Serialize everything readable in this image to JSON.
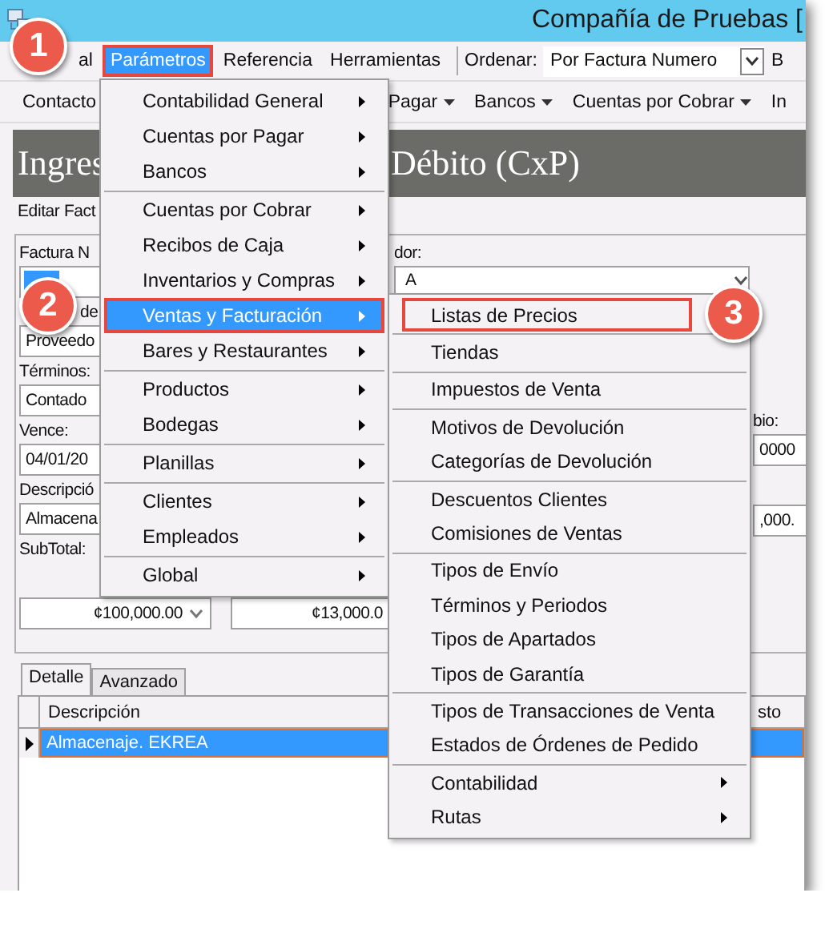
{
  "window": {
    "title": "Compañía de Pruebas ["
  },
  "menu_bar": [
    {
      "label": "al",
      "selected": false,
      "marked": false
    },
    {
      "label": "Parámetros",
      "selected": true,
      "marked": true
    },
    {
      "label": "Referencia",
      "selected": false,
      "marked": false
    },
    {
      "label": "Herramientas",
      "selected": false,
      "marked": false
    }
  ],
  "sort": {
    "label": "Ordenar:",
    "value": "Por Factura Numero"
  },
  "menu_bar_overflow": "B",
  "toolbar": [
    {
      "label": "Contacto",
      "dropdown": false
    },
    {
      "label": "Pagar",
      "dropdown": true
    },
    {
      "label": "Bancos",
      "dropdown": true
    },
    {
      "label": "Cuentas por Cobrar",
      "dropdown": true
    },
    {
      "label": "In",
      "dropdown": false
    }
  ],
  "header": {
    "left": "Ingres",
    "right": "Débito (CxP)"
  },
  "form_tab": "Editar Fact",
  "form": {
    "left": [
      {
        "kind": "label",
        "text": "Factura N"
      },
      {
        "kind": "selection"
      },
      {
        "kind": "label",
        "text": "de"
      },
      {
        "kind": "field",
        "text": "Proveedo"
      },
      {
        "kind": "label",
        "text": "Términos:"
      },
      {
        "kind": "field",
        "text": "Contado"
      },
      {
        "kind": "label",
        "text": "Vence:"
      },
      {
        "kind": "field",
        "text": "04/01/20"
      },
      {
        "kind": "label",
        "text": "Descripció"
      },
      {
        "kind": "field",
        "text": "Almacena"
      },
      {
        "kind": "label",
        "text": "SubTotal:"
      }
    ],
    "amounts": [
      {
        "text": "¢100,000.00",
        "dropdown": true
      },
      {
        "text": "¢13,000.0",
        "dropdown": false
      }
    ],
    "middle": [
      {
        "kind": "label",
        "text": "dor:"
      },
      {
        "kind": "combo",
        "text": "A"
      }
    ],
    "right": [
      {
        "kind": "label",
        "text": "bio:"
      },
      {
        "kind": "field",
        "text": "0000"
      },
      {
        "kind": "field",
        "text": ",000."
      }
    ]
  },
  "tabs": [
    {
      "label": "Detalle",
      "selected": true
    },
    {
      "label": "Avanzado",
      "selected": false
    }
  ],
  "grid": {
    "columns": [
      "Descripción",
      "sto"
    ],
    "rows": [
      {
        "cells": [
          "Almacenaje. EKREA"
        ],
        "selected": true
      }
    ]
  },
  "main_menu": {
    "items": [
      {
        "label": "Contabilidad General",
        "submenu": true,
        "divider_above": false,
        "selected": false,
        "marked": false
      },
      {
        "label": "Cuentas por Pagar",
        "submenu": true,
        "divider_above": false,
        "selected": false,
        "marked": false
      },
      {
        "label": "Bancos",
        "submenu": true,
        "divider_above": false,
        "selected": false,
        "marked": false
      },
      {
        "label": "Cuentas por Cobrar",
        "submenu": true,
        "divider_above": true,
        "selected": false,
        "marked": false
      },
      {
        "label": "Recibos de Caja",
        "submenu": true,
        "divider_above": false,
        "selected": false,
        "marked": false
      },
      {
        "label": "Inventarios y Compras",
        "submenu": true,
        "divider_above": false,
        "selected": false,
        "marked": false
      },
      {
        "label": "Ventas y Facturación",
        "submenu": true,
        "divider_above": false,
        "selected": true,
        "marked": true
      },
      {
        "label": "Bares y Restaurantes",
        "submenu": true,
        "divider_above": false,
        "selected": false,
        "marked": false
      },
      {
        "label": "Productos",
        "submenu": true,
        "divider_above": true,
        "selected": false,
        "marked": false
      },
      {
        "label": "Bodegas",
        "submenu": true,
        "divider_above": false,
        "selected": false,
        "marked": false
      },
      {
        "label": "Planillas",
        "submenu": true,
        "divider_above": true,
        "selected": false,
        "marked": false
      },
      {
        "label": "Clientes",
        "submenu": true,
        "divider_above": true,
        "selected": false,
        "marked": false
      },
      {
        "label": "Empleados",
        "submenu": true,
        "divider_above": false,
        "selected": false,
        "marked": false
      },
      {
        "label": "Global",
        "submenu": true,
        "divider_above": true,
        "selected": false,
        "marked": false
      }
    ]
  },
  "submenu": {
    "items": [
      {
        "label": "Listas de Precios",
        "submenu": false,
        "divider_above": false,
        "selected": false,
        "marked": true
      },
      {
        "label": "Tiendas",
        "submenu": false,
        "divider_above": true,
        "selected": false,
        "marked": false
      },
      {
        "label": "Impuestos de Venta",
        "submenu": false,
        "divider_above": true,
        "selected": false,
        "marked": false
      },
      {
        "label": "Motivos de Devolución",
        "submenu": false,
        "divider_above": true,
        "selected": false,
        "marked": false
      },
      {
        "label": "Categorías de Devolución",
        "submenu": false,
        "divider_above": false,
        "selected": false,
        "marked": false
      },
      {
        "label": "Descuentos Clientes",
        "submenu": false,
        "divider_above": true,
        "selected": false,
        "marked": false
      },
      {
        "label": "Comisiones de Ventas",
        "submenu": false,
        "divider_above": false,
        "selected": false,
        "marked": false
      },
      {
        "label": "Tipos de Envío",
        "submenu": false,
        "divider_above": true,
        "selected": false,
        "marked": false
      },
      {
        "label": "Términos y Periodos",
        "submenu": false,
        "divider_above": false,
        "selected": false,
        "marked": false
      },
      {
        "label": "Tipos de Apartados",
        "submenu": false,
        "divider_above": false,
        "selected": false,
        "marked": false
      },
      {
        "label": "Tipos de Garantía",
        "submenu": false,
        "divider_above": false,
        "selected": false,
        "marked": false
      },
      {
        "label": "Tipos de Transacciones de Venta",
        "submenu": false,
        "divider_above": true,
        "selected": false,
        "marked": false
      },
      {
        "label": "Estados de Órdenes de Pedido",
        "submenu": false,
        "divider_above": false,
        "selected": false,
        "marked": false
      },
      {
        "label": "Contabilidad",
        "submenu": true,
        "divider_above": true,
        "selected": false,
        "marked": false
      },
      {
        "label": "Rutas",
        "submenu": true,
        "divider_above": false,
        "selected": false,
        "marked": false
      }
    ]
  },
  "callouts": [
    "1",
    "2",
    "3"
  ]
}
